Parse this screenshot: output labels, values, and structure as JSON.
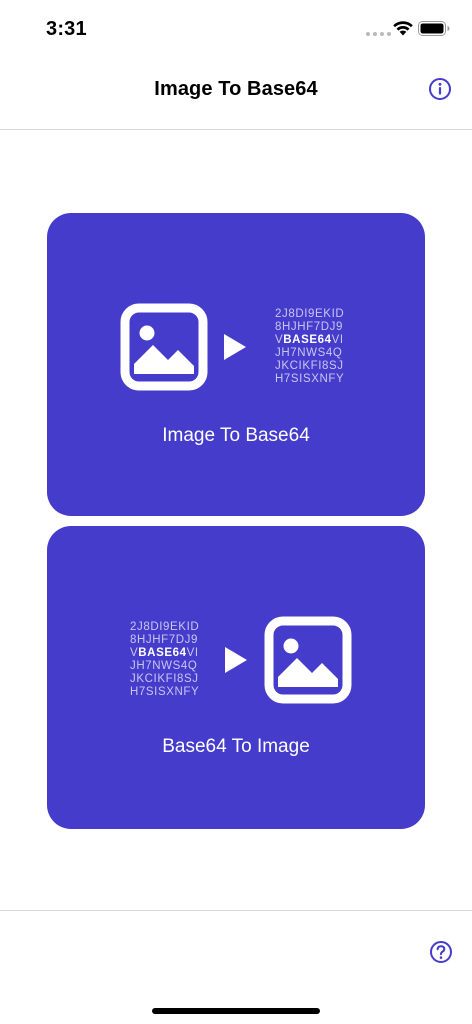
{
  "status_bar": {
    "time": "3:31"
  },
  "nav": {
    "title": "Image To Base64",
    "info_icon": "info-circle-icon"
  },
  "cards": [
    {
      "label": "Image To Base64",
      "code_lines": [
        "2J8DI9EKID",
        "8HJHF7DJ9",
        "V|BASE64|VI",
        "JH7NWS4Q",
        "JKCIKFI8SJ",
        "H7SISXNFY"
      ]
    },
    {
      "label": "Base64 To Image",
      "code_lines": [
        "2J8DI9EKID",
        "8HJHF7DJ9",
        "V|BASE64|VI",
        "JH7NWS4Q",
        "JKCIKFI8SJ",
        "H7SISXNFY"
      ]
    }
  ],
  "code": {
    "line1": "2J8DI9EKID",
    "line2": "8HJHF7DJ9",
    "line3_pre": "V",
    "line3_bold": "BASE64",
    "line3_post": "VI",
    "line4": "JH7NWS4Q",
    "line5": "JKCIKFI8SJ",
    "line6": "H7SISXNFY"
  },
  "footer": {
    "help_icon": "question-circle-icon"
  },
  "colors": {
    "accent": "#453ccc",
    "code_text": "#c9c6f0",
    "divider": "#d8d8d8"
  }
}
